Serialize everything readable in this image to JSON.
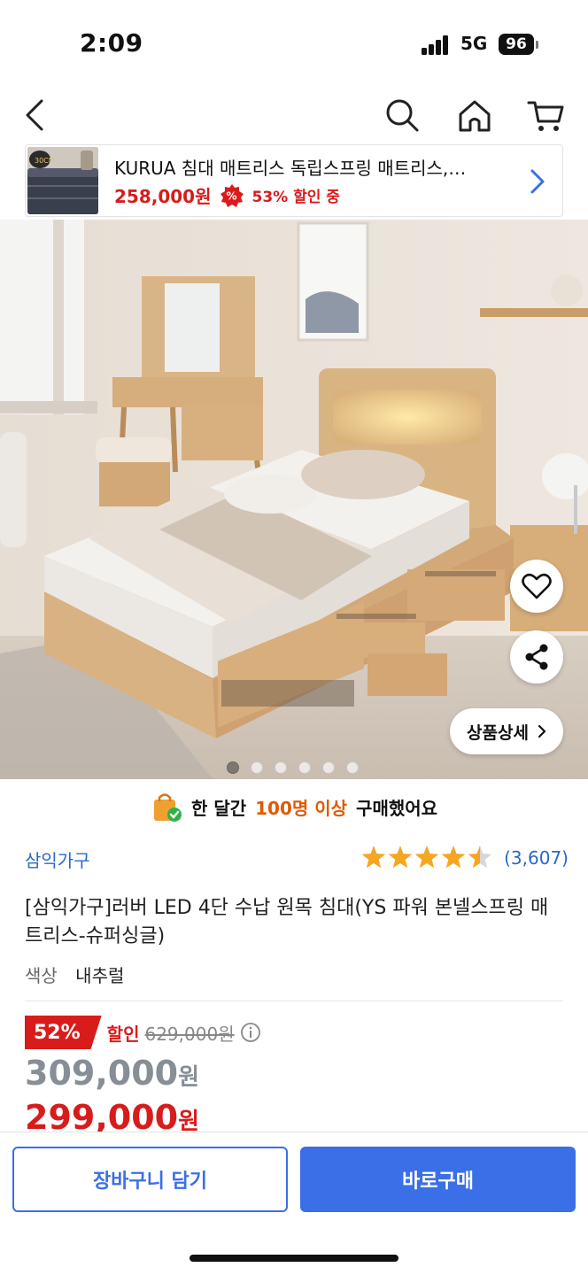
{
  "status_bar": {
    "time": "2:09",
    "network": "5G",
    "battery": "96"
  },
  "nav": {
    "icons": [
      "back-icon",
      "search-icon",
      "home-icon",
      "cart-icon"
    ]
  },
  "mini_bar": {
    "thumb_label": "30CM",
    "title": "KURUA 침대 매트리스 독립스프링 매트리스,…",
    "price": "258,000원",
    "discount": "53% 할인 중"
  },
  "gallery": {
    "detail_button": "상품상세",
    "total_images": 6,
    "active_index": 0
  },
  "purchase_banner": {
    "prefix": "한 달간",
    "highlight": "100명 이상",
    "suffix": "구매했어요"
  },
  "product": {
    "seller": "삼익가구",
    "rating_value": 4.5,
    "review_count": "(3,607)",
    "title": "[삼익가구]러버 LED 4단 수납 원목 침대(YS 파워 본넬스프링 매트리스-슈퍼싱글)",
    "option_label": "색상",
    "option_value": "내추럴"
  },
  "pricing": {
    "discount_pct": "52%",
    "discount_label": "할인",
    "original_price": "629,000원",
    "price": "309,000",
    "final_price": "299,000",
    "unit": "원"
  },
  "actions": {
    "cart_label": "장바구니 담기",
    "buy_label": "바로구매"
  },
  "colors": {
    "accent_blue": "#3b6fe8",
    "sale_red": "#d81c1c",
    "seller_blue": "#2a68c9",
    "star": "#f5a623"
  }
}
